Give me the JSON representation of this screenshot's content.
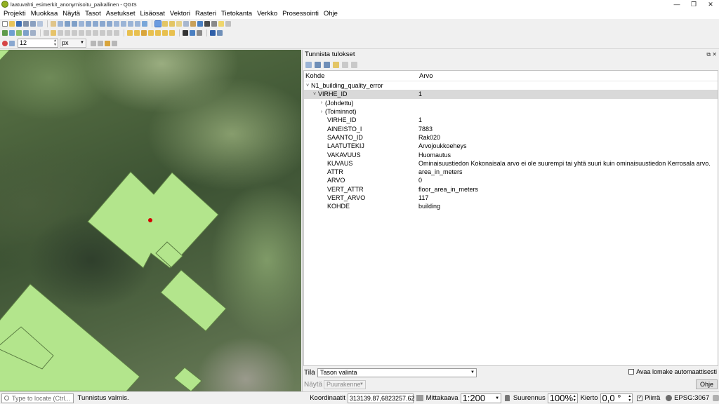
{
  "window": {
    "title": "laatuvahti_esimerkit_anonymisoitu_paikallinen - QGIS",
    "min": "—",
    "max": "❐",
    "close": "✕"
  },
  "menu": [
    "Projekti",
    "Muokkaa",
    "Näytä",
    "Tasot",
    "Asetukset",
    "Lisäosat",
    "Vektori",
    "Rasteri",
    "Tietokanta",
    "Verkko",
    "Prosessointi",
    "Ohje"
  ],
  "toolbar": {
    "snap_size": "12",
    "snap_unit": "px"
  },
  "panel": {
    "title": "Tunnista tulokset",
    "col_feature": "Kohde",
    "col_value": "Arvo",
    "layer_name": "N1_building_quality_error",
    "root_attr": "VIRHE_ID",
    "root_value": "1",
    "derived": "(Johdettu)",
    "actions": "(Toiminnot)",
    "attributes": [
      {
        "key": "VIRHE_ID",
        "value": "1"
      },
      {
        "key": "AINEISTO_I",
        "value": "7883"
      },
      {
        "key": "SAANTO_ID",
        "value": "Rak020"
      },
      {
        "key": "LAATUTEKIJ",
        "value": "Arvojoukkoeheys"
      },
      {
        "key": "VAKAVUUS",
        "value": "Huomautus"
      },
      {
        "key": "KUVAUS",
        "value": "Ominaisuustiedon Kokonaisala arvo ei ole suurempi tai yhtä suuri kuin ominaisuustiedon Kerrosala arvo."
      },
      {
        "key": "ATTR",
        "value": "area_in_meters"
      },
      {
        "key": "ARVO",
        "value": "0"
      },
      {
        "key": "VERT_ATTR",
        "value": "floor_area_in_meters"
      },
      {
        "key": "VERT_ARVO",
        "value": "117"
      },
      {
        "key": "KOHDE",
        "value": "building"
      }
    ],
    "mode_label": "Tila",
    "mode_value": "Tason valinta",
    "auto_open_label": "Avaa lomake automaattisesti",
    "view_label": "Näytä",
    "view_value": "Puurakenne",
    "help_button": "Ohje"
  },
  "status": {
    "locator_placeholder": "Type to locate (Ctrl...",
    "message": "Tunnistus valmis.",
    "coord_label": "Koordinaatit",
    "coord_value": "313139.87,6823257.62",
    "scale_label": "Mittakaava",
    "scale_value": "1:200",
    "magnifier_label": "Suurennus",
    "magnifier_value": "100%",
    "rotation_label": "Kierto",
    "rotation_value": "0,0 °",
    "render_label": "Piirrä",
    "crs": "EPSG:3067"
  },
  "colors": {
    "polygon_fill": "#b3e58c",
    "polygon_stroke": "#5d7f44",
    "marker": "#d40000",
    "selected_row": "#d9d9d9",
    "map_canopy": "#5b7446"
  }
}
